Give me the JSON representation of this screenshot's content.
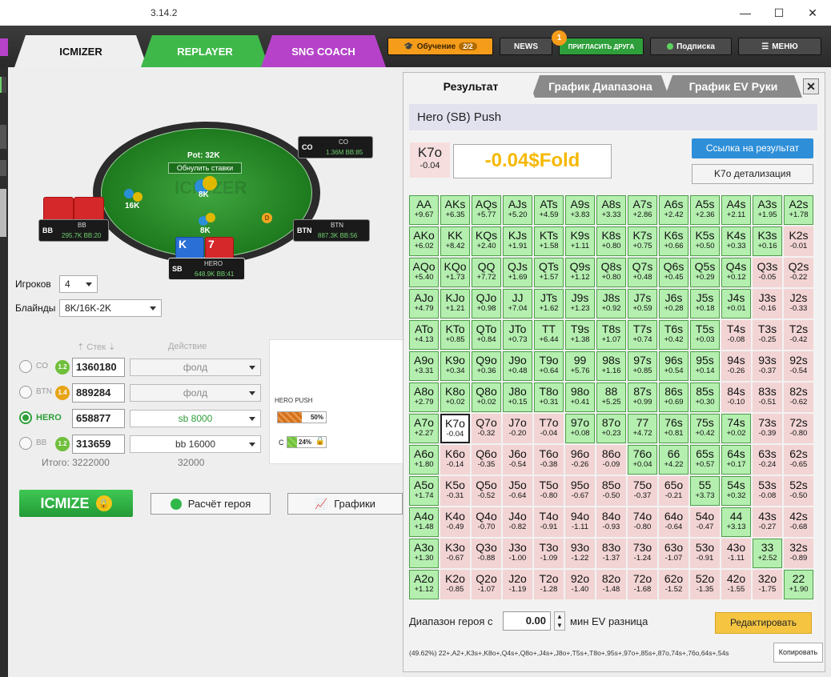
{
  "window": {
    "version": "3.14.2",
    "minimize": "—",
    "maximize": "☐",
    "close": "✕"
  },
  "nav": {
    "tabs": [
      "ICMIZER",
      "REPLAYER",
      "SNG COACH"
    ],
    "learn": "Обучение",
    "learn_badge": "2/2",
    "news": "NEWS",
    "invite": "ПРИГЛАСИТЬ ДРУГА",
    "invite_badge": "1",
    "subscribe": "Подписка",
    "menu": "МЕНЮ"
  },
  "table": {
    "pot": "Pot: 32K",
    "reset": "Обнулить ставки",
    "watermark": "ICMIZER",
    "seats": {
      "co": {
        "pos": "CO",
        "name": "CO",
        "stack": "1.36M",
        "bb": "85"
      },
      "bb": {
        "pos": "BB",
        "name": "BB",
        "stack": "295.7K",
        "bb": "20"
      },
      "btn": {
        "pos": "BTN",
        "name": "BTN",
        "stack": "887.3K",
        "bb": "56"
      },
      "sb": {
        "pos": "SB",
        "name": "HERO",
        "stack": "648.9K",
        "bb": "41"
      }
    },
    "bets": {
      "bb": "16K",
      "center": "8K",
      "sb": "8K"
    },
    "dealer": "D",
    "hero_cards": [
      "K",
      "7"
    ]
  },
  "settings": {
    "players_label": "Игроков",
    "players": "4",
    "blinds_label": "Блайнды",
    "blinds": "8K/16K-2K"
  },
  "players": {
    "stack_header": "Стек",
    "action_header": "Действие",
    "rows": [
      {
        "pos": "CO",
        "badge": "1.2",
        "stack": "1360180",
        "action": "фолд"
      },
      {
        "pos": "BTN",
        "badge": "1.4",
        "stack": "889284",
        "action": "фолд"
      },
      {
        "pos": "HERO",
        "badge": "",
        "stack": "658877",
        "action": "sb 8000"
      },
      {
        "pos": "BB",
        "badge": "1.2",
        "stack": "313659",
        "action": "bb 16000"
      }
    ],
    "total_label": "Итого:",
    "total": "3222000",
    "total_action": "32000"
  },
  "mini": {
    "title": "HERO PUSH",
    "push_pct": "50%",
    "call_label": "C",
    "call_pct": "24%"
  },
  "buttons": {
    "icmize": "ICMIZE",
    "hero_calc": "Расчёт героя",
    "charts": "Графики"
  },
  "result": {
    "tabs": [
      "Результат",
      "График Диапазона",
      "График EV Руки"
    ],
    "title": "Hero (SB) Push",
    "hand": "K7o",
    "hand_ev": "-0.04",
    "result_text": "-0.04$Fold",
    "link_btn": "Ссылка на результат",
    "detail_btn": "K7o детализация",
    "range_label": "Диапазон героя с",
    "range_value": "0.00",
    "range_suffix": "мин EV разница",
    "edit_btn": "Редактировать",
    "range_text": "(49.62%) 22+,A2+,K3s+,K8o+,Q4s+,Q8o+,J4s+,J8o+,T5s+,T8o+,95s+,97o+,85s+,87o,74s+,76o,64s+,54s",
    "copy_btn": "Копировать"
  },
  "colors": {
    "pos": "#b5efb0",
    "neg": "#f2d4d4",
    "accent": "#2e8fd8",
    "icmize": "#2fb74a"
  },
  "chart_data": {
    "type": "heatmap",
    "selected": "K7o",
    "ranks": [
      "A",
      "K",
      "Q",
      "J",
      "T",
      "9",
      "8",
      "7",
      "6",
      "5",
      "4",
      "3",
      "2"
    ],
    "rows": [
      [
        "AA +9.67",
        "AKs +6.35",
        "AQs +5.77",
        "AJs +5.20",
        "ATs +4.59",
        "A9s +3.83",
        "A8s +3.33",
        "A7s +2.86",
        "A6s +2.42",
        "A5s +2.36",
        "A4s +2.11",
        "A3s +1.95",
        "A2s +1.78"
      ],
      [
        "AKo +6.02",
        "KK +8.42",
        "KQs +2.40",
        "KJs +1.91",
        "KTs +1.58",
        "K9s +1.11",
        "K8s +0.80",
        "K7s +0.75",
        "K6s +0.66",
        "K5s +0.50",
        "K4s +0.33",
        "K3s +0.16",
        "K2s -0.01"
      ],
      [
        "AQo +5.40",
        "KQo +1.73",
        "QQ +7.72",
        "QJs +1.69",
        "QTs +1.57",
        "Q9s +1.12",
        "Q8s +0.80",
        "Q7s +0.48",
        "Q6s +0.45",
        "Q5s +0.29",
        "Q4s +0.12",
        "Q3s -0.05",
        "Q2s -0.22"
      ],
      [
        "AJo +4.79",
        "KJo +1.21",
        "QJo +0.98",
        "JJ +7.04",
        "JTs +1.62",
        "J9s +1.23",
        "J8s +0.92",
        "J7s +0.59",
        "J6s +0.28",
        "J5s +0.18",
        "J4s +0.01",
        "J3s -0.16",
        "J2s -0.33"
      ],
      [
        "ATo +4.13",
        "KTo +0.85",
        "QTo +0.84",
        "JTo +0.73",
        "TT +6.44",
        "T9s +1.38",
        "T8s +1.07",
        "T7s +0.74",
        "T6s +0.42",
        "T5s +0.03",
        "T4s -0.08",
        "T3s -0.25",
        "T2s -0.42"
      ],
      [
        "A9o +3.31",
        "K9o +0.34",
        "Q9o +0.36",
        "J9o +0.48",
        "T9o +0.64",
        "99 +5.76",
        "98s +1.16",
        "97s +0.85",
        "96s +0.54",
        "95s +0.14",
        "94s -0.26",
        "93s -0.37",
        "92s -0.54"
      ],
      [
        "A8o +2.79",
        "K8o +0.02",
        "Q8o +0.02",
        "J8o +0.15",
        "T8o +0.31",
        "98o +0.41",
        "88 +5.25",
        "87s +0.99",
        "86s +0.69",
        "85s +0.30",
        "84s -0.10",
        "83s -0.51",
        "82s -0.62"
      ],
      [
        "A7o +2.27",
        "K7o -0.04",
        "Q7o -0.32",
        "J7o -0.20",
        "T7o -0.04",
        "97o +0.08",
        "87o +0.23",
        "77 +4.72",
        "76s +0.81",
        "75s +0.42",
        "74s +0.02",
        "73s -0.39",
        "72s -0.80"
      ],
      [
        "A6o +1.80",
        "K6o -0.14",
        "Q6o -0.35",
        "J6o -0.54",
        "T6o -0.38",
        "96o -0.26",
        "86o -0.09",
        "76o +0.04",
        "66 +4.22",
        "65s +0.57",
        "64s +0.17",
        "63s -0.24",
        "62s -0.65"
      ],
      [
        "A5o +1.74",
        "K5o -0.31",
        "Q5o -0.52",
        "J5o -0.64",
        "T5o -0.80",
        "95o -0.67",
        "85o -0.50",
        "75o -0.37",
        "65o -0.21",
        "55 +3.73",
        "54s +0.32",
        "53s -0.08",
        "52s -0.50"
      ],
      [
        "A4o +1.48",
        "K4o -0.49",
        "Q4o -0.70",
        "J4o -0.82",
        "T4o -0.91",
        "94o -1.11",
        "84o -0.93",
        "74o -0.80",
        "64o -0.64",
        "54o -0.47",
        "44 +3.13",
        "43s -0.27",
        "42s -0.68"
      ],
      [
        "A3o +1.30",
        "K3o -0.67",
        "Q3o -0.88",
        "J3o -1.00",
        "T3o -1.09",
        "93o -1.22",
        "83o -1.37",
        "73o -1.24",
        "63o -1.07",
        "53o -0.91",
        "43o -1.11",
        "33 +2.52",
        "32s -0.89"
      ],
      [
        "A2o +1.12",
        "K2o -0.85",
        "Q2o -1.07",
        "J2o -1.19",
        "T2o -1.28",
        "92o -1.40",
        "82o -1.48",
        "72o -1.68",
        "62o -1.52",
        "52o -1.35",
        "42o -1.55",
        "32o -1.75",
        "22 +1.90"
      ]
    ]
  }
}
